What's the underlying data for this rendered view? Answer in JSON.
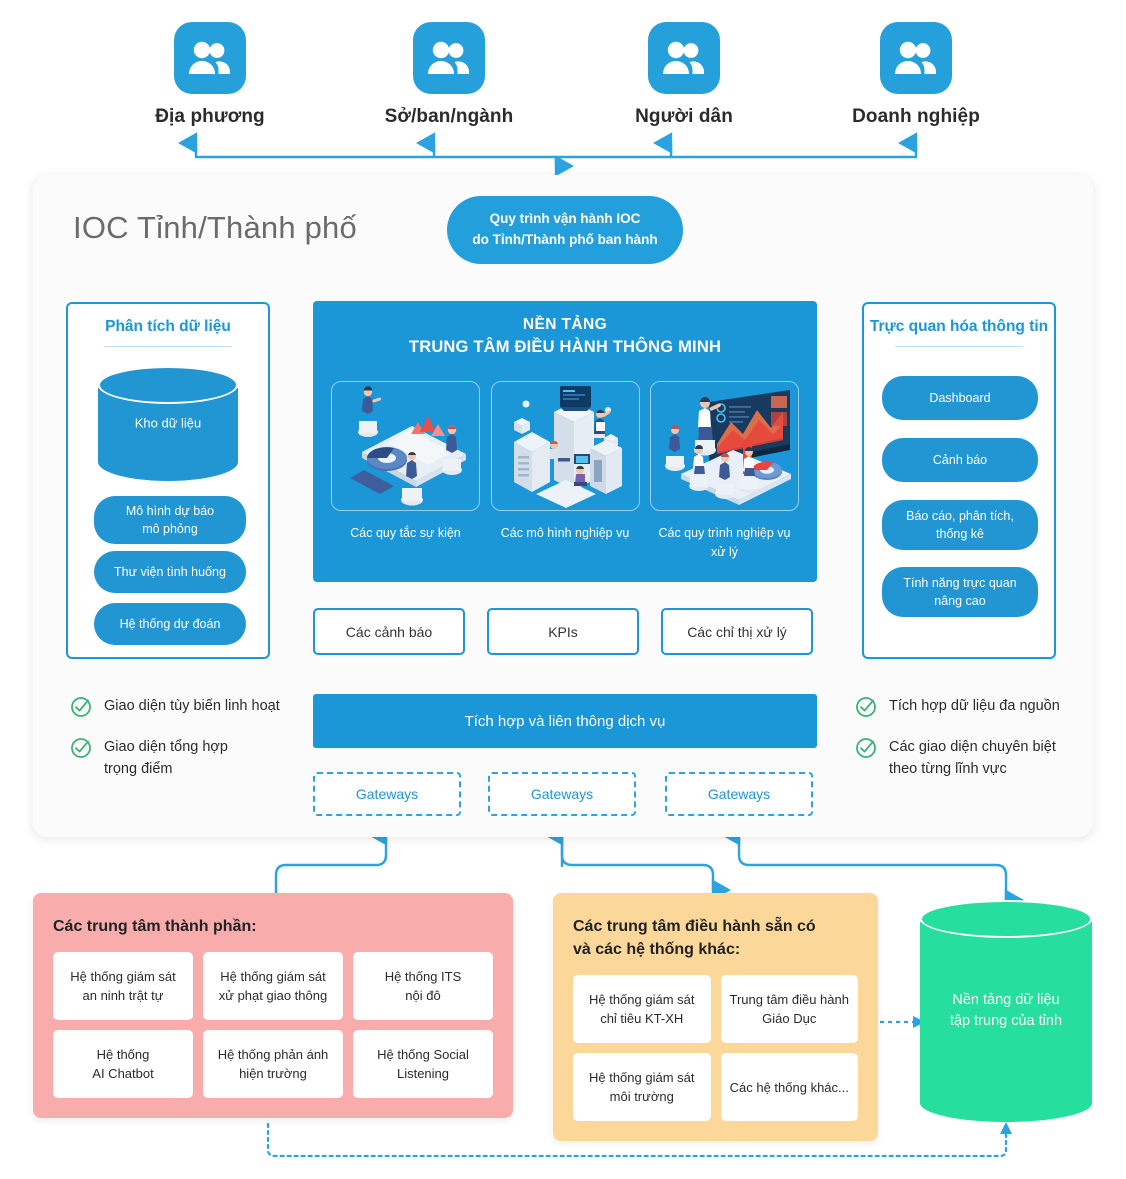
{
  "audiences": [
    {
      "label": "Địa phương",
      "icon": "people-group-icon"
    },
    {
      "label": "Sở/ban/ngành",
      "icon": "people-group-icon"
    },
    {
      "label": "Người dân",
      "icon": "people-group-icon"
    },
    {
      "label": "Doanh nghiệp",
      "icon": "people-group-icon"
    }
  ],
  "ioc": {
    "title": "IOC Tỉnh/Thành phố",
    "process_pill": {
      "line1": "Quy trình vận hành IOC",
      "line2": "do Tỉnh/Thành phố ban hành"
    }
  },
  "analysis_panel": {
    "title": "Phân tích dữ liệu",
    "warehouse_label": "Kho dữ liệu",
    "items": [
      "Mô hình dự báo\nmô phỏng",
      "Thư viện tình huống",
      "Hệ thống dự đoán"
    ]
  },
  "visualization_panel": {
    "title": "Trực quan hóa thông tin",
    "items": [
      "Dashboard",
      "Cảnh báo",
      "Báo cáo, phân tích,\nthống kê",
      "Tính năng trực quan\nnâng cao"
    ]
  },
  "platform": {
    "title_line1": "NỀN TẢNG",
    "title_line2": "TRUNG TÂM ĐIỀU HÀNH THÔNG MINH",
    "cards": [
      {
        "caption": "Các quy tắc\nsự kiện",
        "art": "isometric-analytics-dashboard-illustration"
      },
      {
        "caption": "Các mô hình\nnghiệp vụ",
        "art": "isometric-city-buildings-illustration"
      },
      {
        "caption": "Các quy trình\nnghiệp vụ xử lý",
        "art": "isometric-presentation-screen-illustration"
      }
    ]
  },
  "outputs": [
    "Các cảnh báo",
    "KPIs",
    "Các chỉ thị xử lý"
  ],
  "integration": {
    "label": "Tích hợp và liên thông dịch vụ",
    "gateways": [
      "Gateways",
      "Gateways",
      "Gateways"
    ]
  },
  "left_features": [
    "Giao diện tùy biến linh hoạt",
    "Giao diện tổng hợp\ntrọng điểm"
  ],
  "right_features": [
    "Tích hợp dữ liệu đa nguồn",
    "Các giao diện chuyên biệt\ntheo từng lĩnh vực"
  ],
  "components_group": {
    "title": "Các trung tâm thành phần:",
    "cells": [
      "Hệ thống giám sát\nan ninh trật tự",
      "Hệ thống giám sát\nxử phạt giao thông",
      "Hệ thống ITS\nnội đô",
      "Hệ thống\nAI Chatbot",
      "Hệ thống phản ánh\nhiện trường",
      "Hệ thống Social\nListening"
    ]
  },
  "existing_group": {
    "title": "Các trung tâm điều hành sẵn có\nvà các hệ thống khác:",
    "cells": [
      "Hệ thống giám sát\nchỉ tiêu KT-XH",
      "Trung tâm điều hành\nGiáo Dục",
      "Hệ thống giám sát\nmôi trường",
      "Các hệ thống khác..."
    ]
  },
  "data_platform": {
    "label": "Nền tảng dữ liệu\ntập trung của tỉnh"
  },
  "colors": {
    "accent_blue": "#1B96D6",
    "icon_blue": "#26A0DA",
    "pill_blue": "#2196D3",
    "pink": "#F8ACAC",
    "orange": "#FCD79A",
    "green": "#26DE9E",
    "check_green": "#3BB273",
    "panel_bg": "#FBFBFB"
  }
}
